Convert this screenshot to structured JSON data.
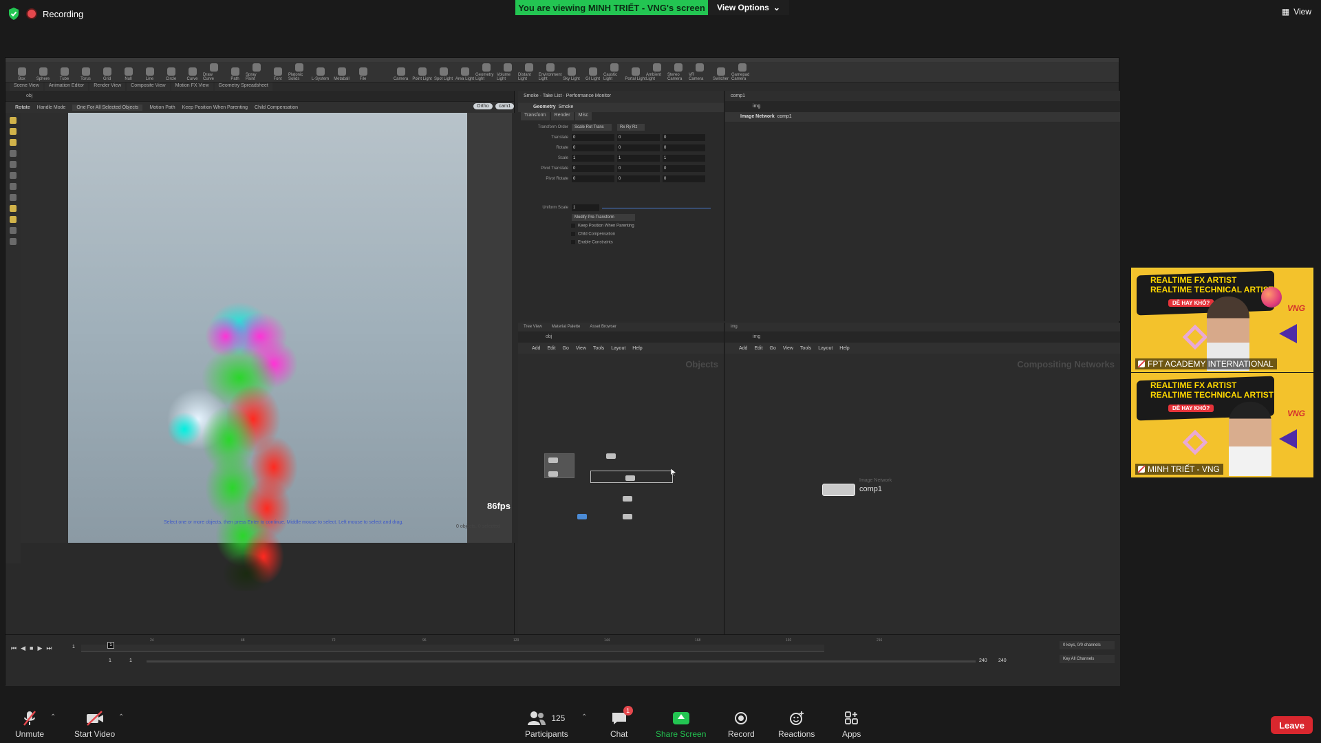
{
  "zoom": {
    "recording_label": "Recording",
    "viewing_banner": "You are viewing MINH TRIẾT - VNG's screen",
    "view_options": "View Options",
    "view_label": "View",
    "toolbar": {
      "unmute": "Unmute",
      "start_video": "Start Video",
      "participants": "Participants",
      "participants_count": "125",
      "chat": "Chat",
      "chat_badge": "1",
      "share_screen": "Share Screen",
      "record": "Record",
      "reactions": "Reactions",
      "apps": "Apps",
      "leave": "Leave"
    },
    "participants": [
      {
        "name": "FPT ACADEMY INTERNATIONAL"
      },
      {
        "name": "MINH TRIẾT - VNG"
      }
    ],
    "tile_banner": {
      "line1": "REALTIME FX ARTIST",
      "line2": "REALTIME TECHNICAL ARTIST",
      "tag": "DỄ HAY KHÓ?",
      "brand": "VNG"
    }
  },
  "houdini": {
    "shelf_tools": [
      "Box",
      "Sphere",
      "Tube",
      "Torus",
      "Grid",
      "Null",
      "Line",
      "Circle",
      "Curve",
      "Draw Curve",
      "Path",
      "Spray Paint",
      "Font",
      "Platonic Solids",
      "L-System",
      "Metaball",
      "File",
      "Camera",
      "Point Light",
      "Spot Light",
      "Area Light",
      "Geometry Light",
      "Volume Light",
      "Distant Light",
      "Environment Light",
      "Sky Light",
      "GI Light",
      "Caustic Light",
      "Portal Light",
      "Ambient Light",
      "Stereo Camera",
      "VR Camera",
      "Switcher",
      "Gamepad Camera"
    ],
    "scene_tabs": [
      "Scene View",
      "Animation Editor",
      "Render View",
      "Composite View",
      "Motion FX View",
      "Geometry Spreadsheet"
    ],
    "scene_path": "obj",
    "scene_options": {
      "rotate": "Rotate",
      "handle_mode": "Handle Mode",
      "one_for_all": "One For All Selected Objects",
      "motion_path": "Motion Path",
      "keep_position": "Keep Position When Parenting",
      "child_comp": "Child Compensation"
    },
    "viewport": {
      "ortho": "Ortho",
      "cam": "cam1",
      "fps": "86fps",
      "hint": "Select one or more objects, then press Enter to continue. Middle mouse to select. Left mouse to select and drag.",
      "objcount": "0 objects, 0 selected"
    },
    "params": {
      "tabs_header": [
        "Smoke",
        "Take List",
        "Performance Monitor"
      ],
      "path": "obj",
      "node_type": "Geometry",
      "node_name": "Smoke",
      "tabs": [
        "Transform",
        "Render",
        "Misc"
      ],
      "transform_order_label": "Transform Order",
      "transform_order": "Scale Rot Trans",
      "rot_order": "Rx Ry Rz",
      "rows": [
        {
          "label": "Translate",
          "values": [
            "0",
            "0",
            "0"
          ]
        },
        {
          "label": "Rotate",
          "values": [
            "0",
            "0",
            "0"
          ]
        },
        {
          "label": "Scale",
          "values": [
            "1",
            "1",
            "1"
          ]
        },
        {
          "label": "Pivot Translate",
          "values": [
            "0",
            "0",
            "0"
          ]
        },
        {
          "label": "Pivot Rotate",
          "values": [
            "0",
            "0",
            "0"
          ]
        }
      ],
      "uniform_scale_label": "Uniform Scale",
      "uniform_scale": "1",
      "modify_pre": "Modify Pre-Transform",
      "checks": [
        "Keep Position When Parenting",
        "Child Compensation",
        "Enable Constraints"
      ]
    },
    "image_panel": {
      "tab": "comp1",
      "path": "img",
      "type": "Image Network",
      "name": "comp1"
    },
    "obj_net": {
      "tabs": [
        "Tree View",
        "Material Palette",
        "Asset Browser"
      ],
      "path": "obj",
      "menu": [
        "Add",
        "Edit",
        "Go",
        "View",
        "Tools",
        "Layout",
        "Help"
      ],
      "title": "Objects"
    },
    "comp_net": {
      "path": "img",
      "menu": [
        "Add",
        "Edit",
        "Go",
        "View",
        "Tools",
        "Layout",
        "Help"
      ],
      "title": "Compositing Networks",
      "node_sub": "Image Network",
      "node_name": "comp1"
    },
    "timeline": {
      "frame": "1",
      "start": "1",
      "start2": "1",
      "end": "240",
      "end2": "240",
      "keys": "0 keys, 0/0 channels",
      "key_all": "Key All Channels",
      "ticks": [
        "24",
        "48",
        "72",
        "96",
        "120",
        "144",
        "168",
        "192",
        "216"
      ]
    }
  }
}
